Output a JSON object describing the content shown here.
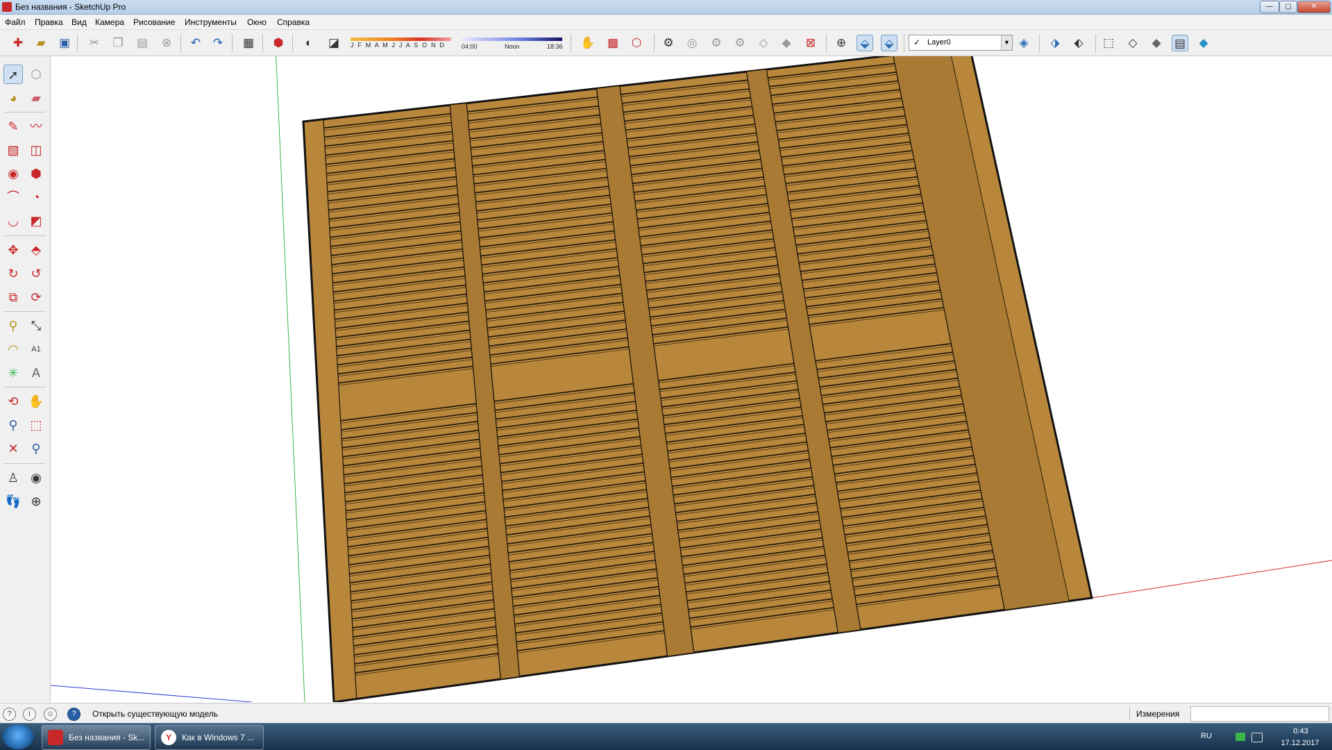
{
  "window": {
    "title": "Без названия - SketchUp Pro",
    "controls": [
      "minimize",
      "maximize",
      "close"
    ]
  },
  "menu": {
    "items": [
      "Файл",
      "Правка",
      "Вид",
      "Камера",
      "Рисование",
      "Инструменты",
      "Окно",
      "Справка"
    ]
  },
  "toolbar": {
    "shadow": {
      "months": "J F M A M J J A S O N D",
      "time_start": "04:00",
      "time_noon": "Noon",
      "time_end": "18:36"
    },
    "layer": {
      "check": "✓",
      "name": "Layer0"
    },
    "icons": [
      "new-icon",
      "open-icon",
      "save-icon",
      "cut-icon",
      "copy-icon",
      "paste-icon",
      "erase-icon",
      "undo-icon",
      "redo-icon",
      "print-icon",
      "model-info-icon",
      "shadows-toggle-icon",
      "fog-icon",
      "hand-icon",
      "warehouse-icon",
      "extension-icon",
      "xray-icon",
      "section-icon",
      "iso-icon",
      "top-icon",
      "front-icon",
      "right-icon",
      "back-icon",
      "left-icon",
      "zoom-extents-icon",
      "camera-perspective-icon",
      "camera-parallel-icon",
      "layer-manager-icon",
      "xray-style-icon",
      "wireframe-icon",
      "hidden-line-icon",
      "shaded-icon",
      "textured-icon",
      "monochrome-icon",
      "style-icon"
    ]
  },
  "left_toolbar": {
    "tools": [
      "select-icon",
      "component-icon",
      "paint-bucket-icon",
      "eraser-icon",
      "pencil-icon",
      "freehand-icon",
      "rectangle-icon",
      "rotated-rectangle-icon",
      "circle-icon",
      "polygon-icon",
      "arc-icon",
      "pie-icon",
      "arc-3pt-icon",
      "follow-shape-icon",
      "move-icon",
      "push-pull-icon",
      "rotate-icon",
      "follow-me-icon",
      "scale-icon",
      "offset-icon",
      "tape-measure-icon",
      "dimension-icon",
      "protractor-icon",
      "text-icon",
      "axes-icon",
      "3d-text-icon",
      "orbit-icon",
      "pan-icon",
      "zoom-icon",
      "zoom-window-icon",
      "zoom-extents-icon",
      "previous-view-icon",
      "position-camera-icon",
      "look-around-icon",
      "walk-icon",
      "section-plane-icon"
    ]
  },
  "status": {
    "hint": "Открыть существующую модель",
    "measure_label": "Измерения",
    "measure_value": ""
  },
  "taskbar": {
    "tasks": [
      {
        "label": "Без названия - Sk..."
      },
      {
        "label": "Как в Windows 7 ..."
      }
    ],
    "language": "RU",
    "time": "0:43",
    "date": "17.12.2017"
  },
  "colors": {
    "wood": "#b8873c",
    "wood_dark": "#a87a34",
    "axis_green": "#3bb54a",
    "axis_red": "#d22a2a",
    "axis_blue": "#2b3ad6",
    "accent": "#c8282a"
  }
}
